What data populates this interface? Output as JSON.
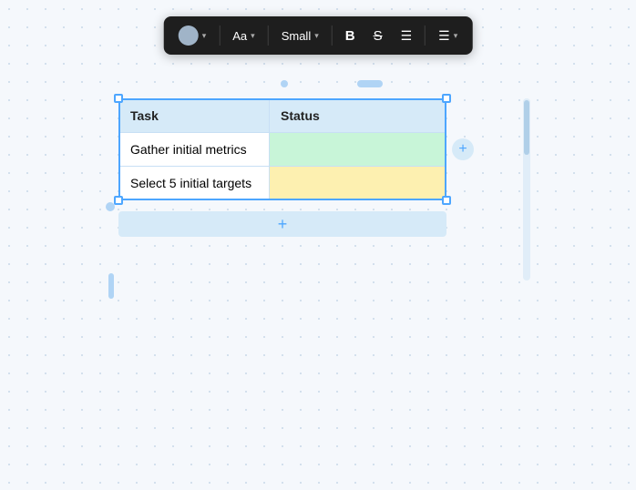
{
  "toolbar": {
    "font_size_label": "Aa",
    "size_label": "Small",
    "bold_label": "B",
    "strikethrough_label": "S",
    "list_label": "≡",
    "menu_label": "≡",
    "chevron": "▾"
  },
  "table": {
    "col1_header": "Task",
    "col2_header": "Status",
    "rows": [
      {
        "task": "Gather initial metrics",
        "status": "",
        "status_color": "green"
      },
      {
        "task": "Select 5 initial targets",
        "status": "",
        "status_color": "yellow"
      }
    ]
  },
  "buttons": {
    "add_column": "+",
    "add_row": "+"
  },
  "decorative": {
    "top_dot": "•",
    "top_pill": ""
  }
}
